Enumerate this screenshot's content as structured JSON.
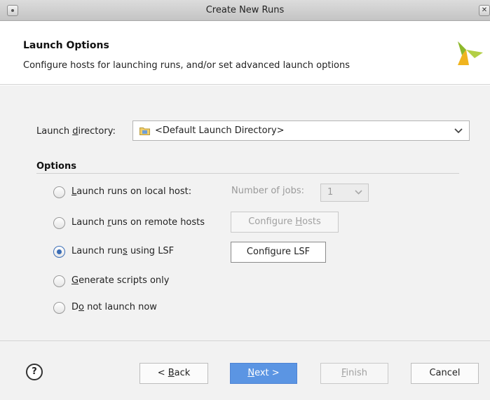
{
  "window": {
    "title": "Create New Runs"
  },
  "header": {
    "title": "Launch Options",
    "subtitle": "Configure hosts for launching runs, and/or set advanced launch options"
  },
  "launch_directory": {
    "label_pre": "Launch ",
    "label_mn": "d",
    "label_post": "irectory:",
    "value": "<Default Launch Directory>"
  },
  "options": {
    "heading": "Options",
    "items": [
      {
        "pre": "",
        "mn": "L",
        "post": "aunch runs on local host:",
        "selected": false
      },
      {
        "pre": "Launch ",
        "mn": "r",
        "post": "uns on remote hosts",
        "selected": false
      },
      {
        "pre": "Launch run",
        "mn": "s",
        "post": " using LSF",
        "selected": true
      },
      {
        "pre": "",
        "mn": "G",
        "post": "enerate scripts only",
        "selected": false
      },
      {
        "pre": "D",
        "mn": "o",
        "post": " not launch now",
        "selected": false
      }
    ],
    "jobs_label_pre": "Number of ",
    "jobs_label_mn": "j",
    "jobs_label_post": "obs:",
    "jobs_value": "1",
    "configure_hosts": {
      "pre": "Configure ",
      "mn": "H",
      "post": "osts",
      "enabled": false
    },
    "configure_lsf": {
      "pre": "Confi",
      "mn": "g",
      "post": "ure LSF",
      "enabled": true
    }
  },
  "footer": {
    "help": "?",
    "back": {
      "pre": "< ",
      "mn": "B",
      "post": "ack"
    },
    "next": {
      "pre": "",
      "mn": "N",
      "post": "ext >"
    },
    "finish": {
      "pre": "",
      "mn": "F",
      "post": "inish"
    },
    "cancel": "Cancel"
  },
  "colors": {
    "accent": "#5b95e3",
    "logo_green": "#9bbf2a",
    "logo_yellow": "#f0b41e"
  },
  "icons": [
    "menu-icon",
    "close-icon",
    "logo-icon",
    "folder-icon",
    "chevron-down-icon",
    "help-icon"
  ]
}
